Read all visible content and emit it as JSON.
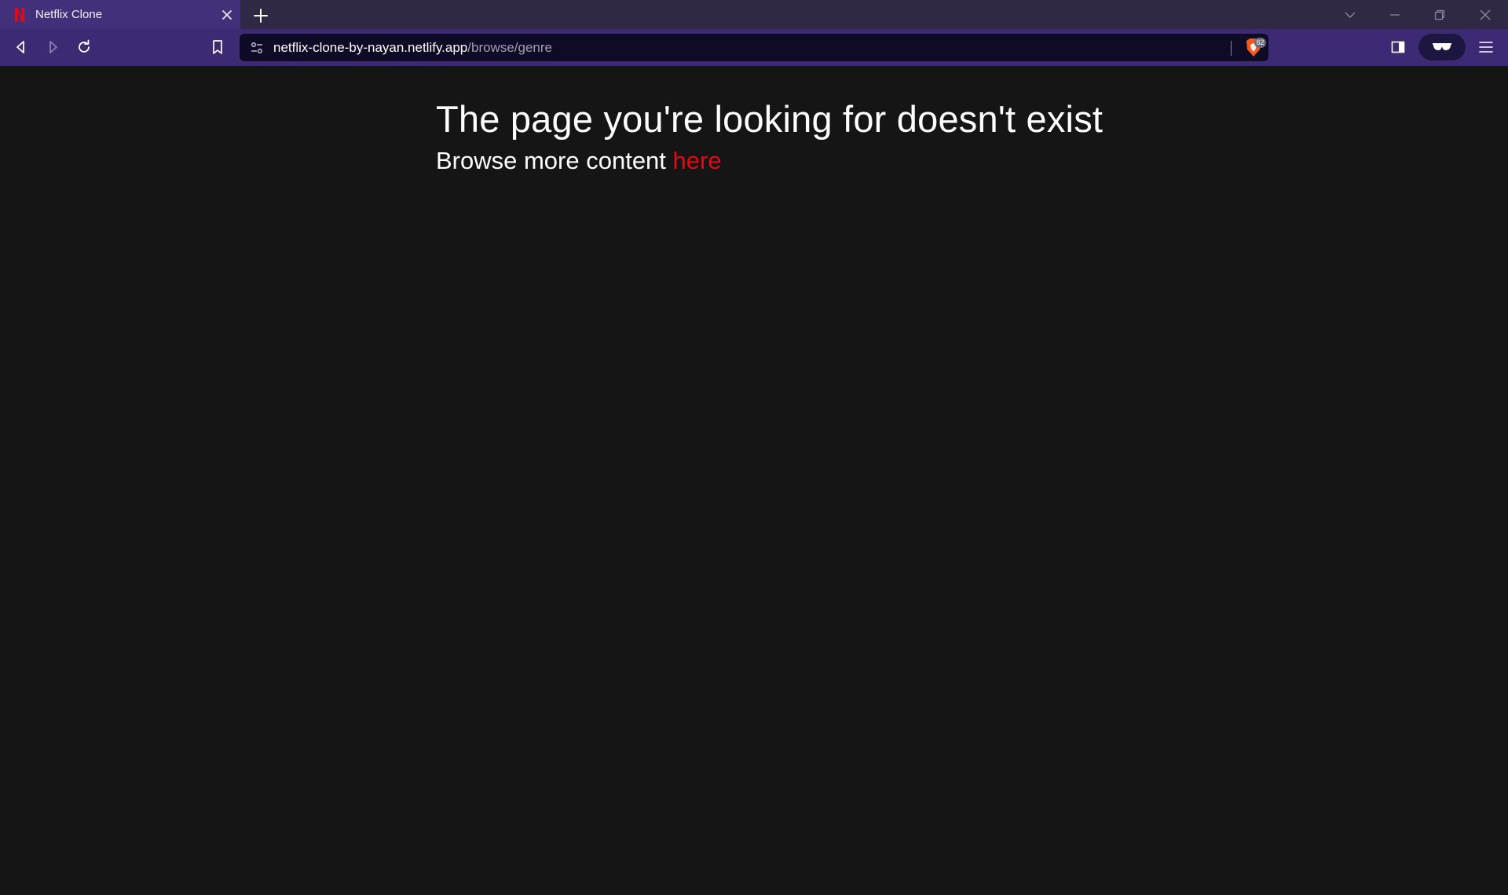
{
  "browser": {
    "tab": {
      "title": "Netflix Clone",
      "favicon": "netflix-n-icon"
    },
    "address_bar": {
      "host": "netflix-clone-by-nayan.netlify.app",
      "path": "/browse/genre"
    },
    "shields_count": "62",
    "colors": {
      "tabstrip": "#302845",
      "active_tab": "#43307a",
      "toolbar": "#3d2a74",
      "omnibox": "#0f0b26"
    }
  },
  "page": {
    "headline": "The page you're looking for doesn't exist",
    "subline_prefix": "Browse more content",
    "link_text": "here",
    "colors": {
      "background": "#151515",
      "text": "#ffffff",
      "link": "#e50914"
    }
  }
}
